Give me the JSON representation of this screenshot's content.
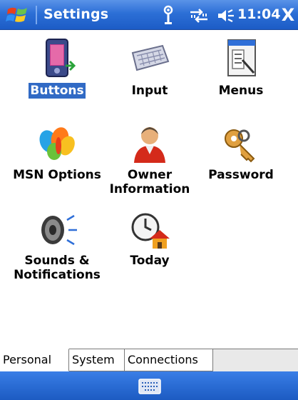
{
  "titlebar": {
    "title": "Settings",
    "time": "11:04",
    "close_label": "X",
    "icons": [
      "windows-start-icon",
      "antenna-icon",
      "connectivity-icon",
      "volume-icon"
    ]
  },
  "items": [
    {
      "label": "Buttons",
      "icon": "buttons-icon",
      "selected": true
    },
    {
      "label": "Input",
      "icon": "keyboard-icon"
    },
    {
      "label": "Menus",
      "icon": "menus-icon"
    },
    {
      "label": "MSN Options",
      "icon": "msn-butterfly-icon"
    },
    {
      "label_line1": "Owner",
      "label_line2": "Information",
      "icon": "owner-person-icon"
    },
    {
      "label": "Password",
      "icon": "keys-icon"
    },
    {
      "label_line1": "Sounds &",
      "label_line2": "Notifications",
      "icon": "speaker-icon"
    },
    {
      "label": "Today",
      "icon": "today-clock-house-icon"
    }
  ],
  "tabs": [
    {
      "label": "Personal",
      "active": true
    },
    {
      "label": "System",
      "active": false
    },
    {
      "label": "Connections",
      "active": false
    }
  ],
  "softbar": {
    "icon": "keyboard-icon"
  },
  "colors": {
    "titlebar": "#2c6fd6",
    "selection": "#316ac5"
  }
}
